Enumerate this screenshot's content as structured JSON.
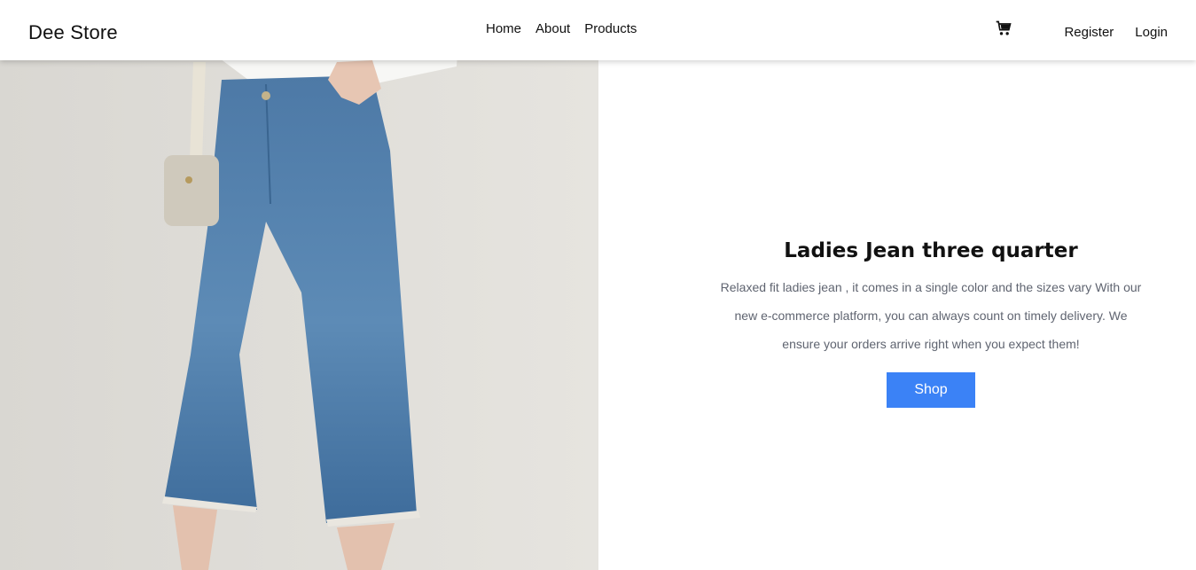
{
  "navbar": {
    "brand": "Dee Store",
    "links": [
      "Home",
      "About",
      "Products"
    ],
    "cart_icon": "cart-icon",
    "register": "Register",
    "login": "Login"
  },
  "hero": {
    "image": "photo-woman-in-cropped-blue-jeans-with-handbag",
    "title": "Ladies Jean three quarter",
    "description": "Relaxed fit ladies jean , it comes in a single color and the sizes vary With our new e-commerce platform, you can always count on timely delivery. We ensure your orders arrive right when you expect them!",
    "button": "Shop"
  },
  "colors": {
    "accent": "#3b82f6",
    "text_muted": "#5f6470"
  }
}
